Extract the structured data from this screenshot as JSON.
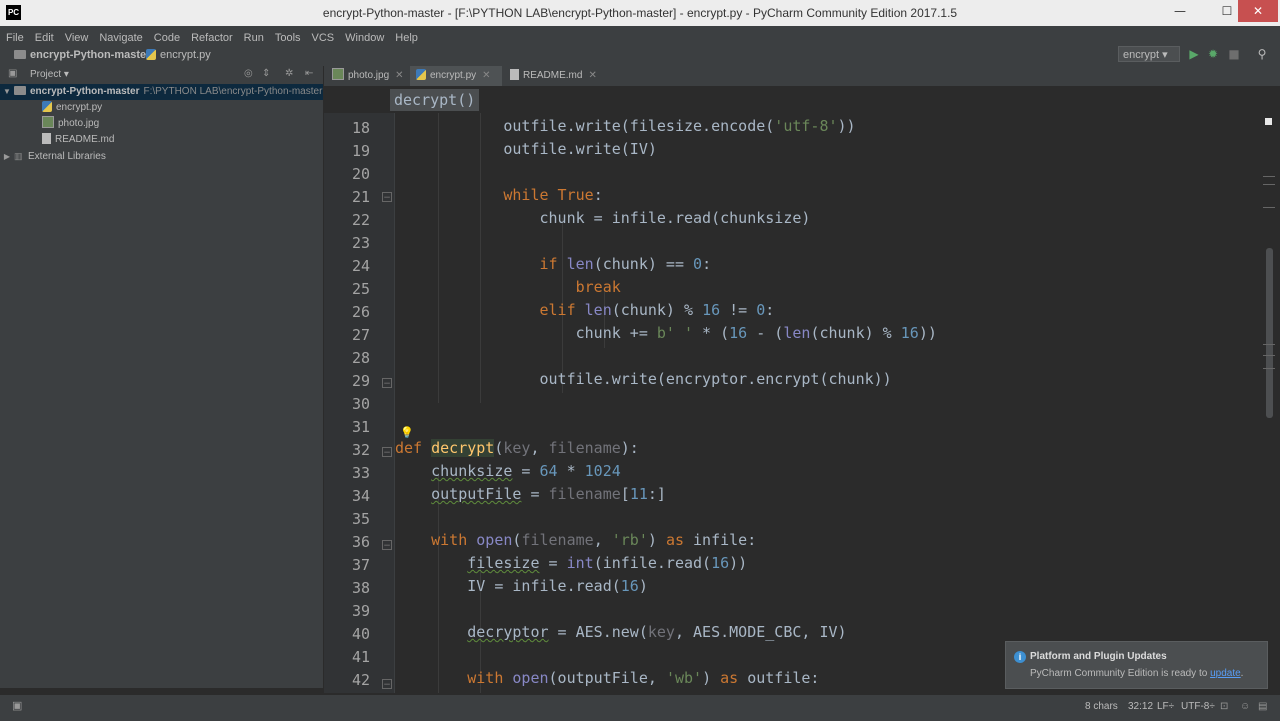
{
  "window": {
    "title": "encrypt-Python-master - [F:\\PYTHON LAB\\encrypt-Python-master] - encrypt.py - PyCharm Community Edition 2017.1.5",
    "app_icon_text": "PC",
    "minimize_glyph": "—",
    "maximize_glyph": "☐",
    "close_glyph": "✕"
  },
  "menu": [
    "File",
    "Edit",
    "View",
    "Navigate",
    "Code",
    "Refactor",
    "Run",
    "Tools",
    "VCS",
    "Window",
    "Help"
  ],
  "navbar": {
    "project": "encrypt-Python-master",
    "file": "encrypt.py",
    "run_config": "encrypt ▾"
  },
  "project_panel": {
    "header": "Project ▾",
    "tree": [
      {
        "label": "encrypt-Python-master",
        "path": "F:\\PYTHON LAB\\encrypt-Python-master",
        "type": "folder",
        "expanded": true,
        "selected": true
      },
      {
        "label": "encrypt.py",
        "type": "python"
      },
      {
        "label": "photo.jpg",
        "type": "image"
      },
      {
        "label": "README.md",
        "type": "markdown"
      },
      {
        "label": "External Libraries",
        "type": "library",
        "expanded": false
      }
    ]
  },
  "tabs": [
    {
      "label": "photo.jpg",
      "active": false
    },
    {
      "label": "encrypt.py",
      "active": true
    },
    {
      "label": "README.md",
      "active": false
    }
  ],
  "breadcrumb": "decrypt()",
  "code": {
    "line_numbers": [
      "18",
      "19",
      "20",
      "21",
      "22",
      "23",
      "24",
      "25",
      "26",
      "27",
      "28",
      "29",
      "30",
      "31",
      "32",
      "33",
      "34",
      "35",
      "36",
      "37",
      "38",
      "39",
      "40",
      "41",
      "42"
    ]
  },
  "notification": {
    "title": "Platform and Plugin Updates",
    "body": "PyCharm Community Edition is ready to ",
    "link": "update",
    "body_end": "."
  },
  "status": {
    "selection": "8 chars",
    "position": "32:12",
    "line_sep": "LF÷",
    "encoding": "UTF-8÷"
  },
  "colors": {
    "editor_bg": "#2b2b2b",
    "panel_bg": "#3c3f41",
    "keyword": "#cc7832",
    "number": "#6897bb",
    "string": "#6a8759",
    "builtin": "#8888c6"
  }
}
